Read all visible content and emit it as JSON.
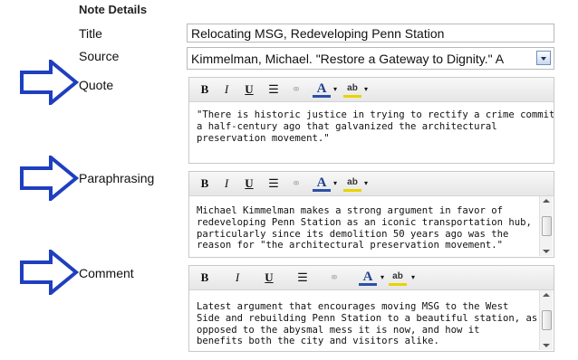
{
  "heading": "Note Details",
  "labels": {
    "title": "Title",
    "source": "Source",
    "quote": "Quote",
    "paraphrasing": "Paraphrasing",
    "comment": "Comment"
  },
  "title_value": "Relocating MSG, Redeveloping Penn Station",
  "source_value": "Kimmelman, Michael. \"Restore a Gateway to Dignity.\" A",
  "toolbar": {
    "bold": "B",
    "italic": "I",
    "underline": "U",
    "list_icon": "☰",
    "link_icon": "⚭",
    "font_color": "A",
    "dropdown": "▾",
    "highlight": "ab"
  },
  "quote_text": "\"There is historic justice in trying to rectify a crime committed\na half-century ago that galvanized the architectural\npreservation movement.\"",
  "paraphrasing_text": "Michael Kimmelman makes a strong argument in favor of\nredeveloping Penn Station as an iconic transportation hub,\nparticularly since its demolition 50 years ago was the\nreason for \"the architectural preservation movement.\"",
  "comment_text": "Latest argument that encourages moving MSG to the West\nSide and rebuilding Penn Station to a beautiful station, as\nopposed to the abysmal mess it is now, and how it\nbenefits both the city and visitors alike.",
  "colors": {
    "arrow": "#1f3fbf",
    "border": "#b9b9b9"
  }
}
